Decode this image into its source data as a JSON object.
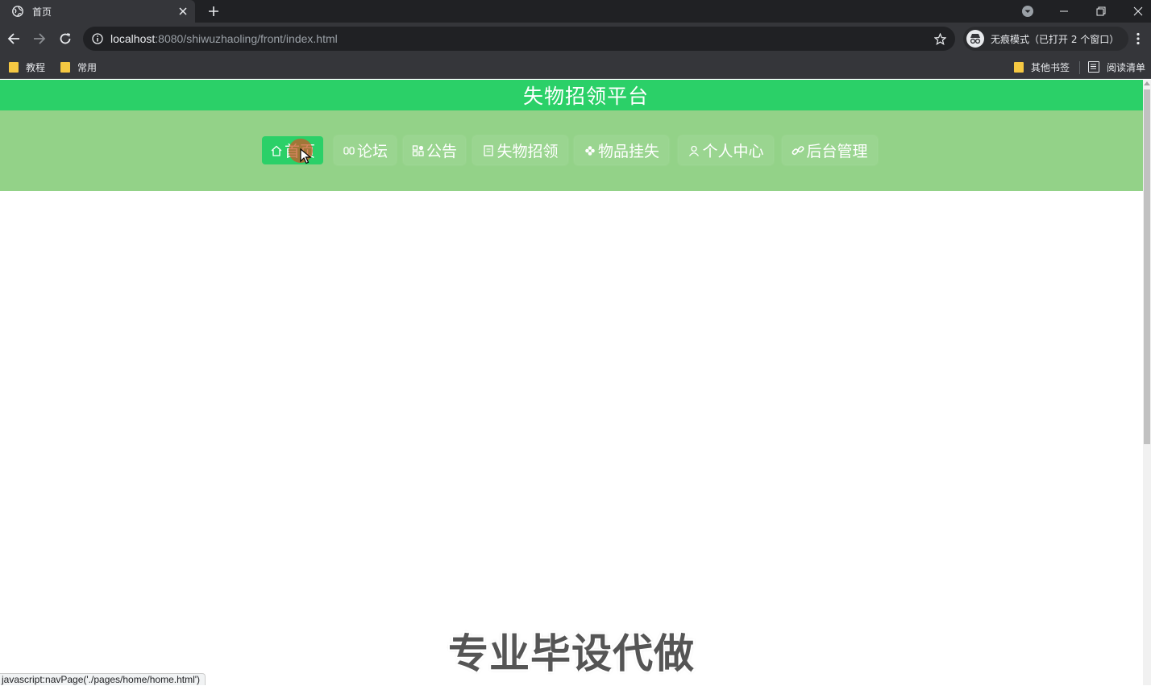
{
  "browser": {
    "tab": {
      "title": "首页"
    },
    "address": {
      "host": "localhost",
      "path": ":8080/shiwuzhaoling/front/index.html"
    },
    "incognito_label": "无痕模式（已打开 2 个窗口）",
    "bookmarks": [
      {
        "label": "教程"
      },
      {
        "label": "常用"
      }
    ],
    "other_bookmarks": "其他书签",
    "reading_list": "阅读清单",
    "status_url": "javascript:navPage('./pages/home/home.html')"
  },
  "site": {
    "title": "失物招领平台",
    "nav": [
      {
        "label": "首页",
        "icon": "home-icon",
        "active": true
      },
      {
        "label": "论坛",
        "icon": "chat-icon",
        "active": false
      },
      {
        "label": "公告",
        "icon": "grid-icon",
        "active": false
      },
      {
        "label": "失物招领",
        "icon": "document-icon",
        "active": false
      },
      {
        "label": "物品挂失",
        "icon": "snowflake-icon",
        "active": false
      },
      {
        "label": "个人中心",
        "icon": "user-icon",
        "active": false
      },
      {
        "label": "后台管理",
        "icon": "link-icon",
        "active": false
      }
    ],
    "watermark": "专业毕设代做"
  },
  "colors": {
    "header_green": "#2bd068",
    "nav_green": "#93d288",
    "active_green": "#2bd068"
  }
}
